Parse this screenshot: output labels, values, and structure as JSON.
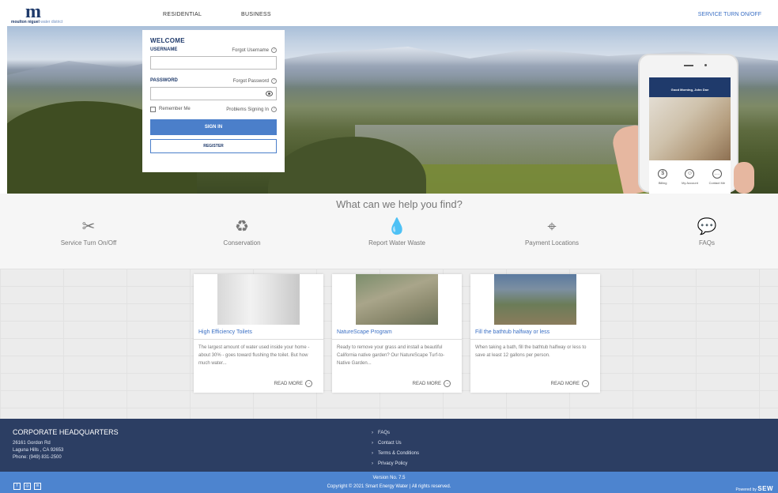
{
  "header": {
    "logo": {
      "word1": "moulton niguel",
      "word2": "water district"
    },
    "tabs": [
      {
        "label": "RESIDENTIAL"
      },
      {
        "label": "BUSINESS"
      }
    ],
    "service_link": "SERVICE TURN ON/OFF"
  },
  "login": {
    "welcome": "WELCOME",
    "username_label": "USERNAME",
    "forgot_username": "Forgot Username",
    "password_label": "PASSWORD",
    "forgot_password": "Forgot Password",
    "remember_me": "Remember Me",
    "problems": "Problems Signing In",
    "sign_in": "SIGN IN",
    "register": "REGISTER",
    "username_value": "",
    "password_value": ""
  },
  "phone": {
    "greeting": "Good Morning, John Doe",
    "icons": [
      {
        "icon": "dollar-icon",
        "label": "Billing"
      },
      {
        "icon": "user-icon",
        "label": "My Account"
      },
      {
        "icon": "chat-icon",
        "label": "Contact Me"
      }
    ]
  },
  "help": {
    "title": "What can we help you find?",
    "items": [
      {
        "icon": "tools-icon",
        "label": "Service Turn On/Off"
      },
      {
        "icon": "recycle-icon",
        "label": "Conservation"
      },
      {
        "icon": "water-drop-icon",
        "label": "Report Water Waste"
      },
      {
        "icon": "location-pin-icon",
        "label": "Payment Locations"
      },
      {
        "icon": "chat-icon",
        "label": "FAQs"
      }
    ]
  },
  "cards": [
    {
      "title": "High Efficiency Toilets",
      "body": "The largest amount of water used inside your home - about 30% - goes toward flushing the toilet. But how much water...",
      "more": "READ MORE"
    },
    {
      "title": "NatureScape Program",
      "body": "Ready to remove your grass and install a beautiful California native garden? Our NatureScape Turf-to-Native Garden...",
      "more": "READ MORE"
    },
    {
      "title": "Fill the bathtub halfway or less",
      "body": "When taking a bath, fill the bathtub halfway or less to save at least 12 gallons per person.",
      "more": "READ MORE"
    }
  ],
  "footer": {
    "hq_title": "CORPORATE HEADQUARTERS",
    "address1": "26161 Gordon Rd",
    "address2": "Laguna Hills , CA 92653",
    "phone": "Phone: (949) 831-2500",
    "links": [
      {
        "label": "FAQs"
      },
      {
        "label": "Contact Us"
      },
      {
        "label": "Terms & Conditions"
      },
      {
        "label": "Privacy Policy"
      }
    ]
  },
  "bottom": {
    "version": "Version No. 7.5",
    "copyright": "Copyright © 2021 Smart Energy Water | All rights reserved.",
    "powered": "Powered by",
    "brand": "SEW",
    "social": [
      {
        "icon": "facebook-icon"
      },
      {
        "icon": "instagram-icon"
      },
      {
        "icon": "linkedin-icon"
      }
    ]
  },
  "colors": {
    "accent": "#4b7fca",
    "navy": "#2c3e63",
    "link": "#3a6fc4"
  }
}
